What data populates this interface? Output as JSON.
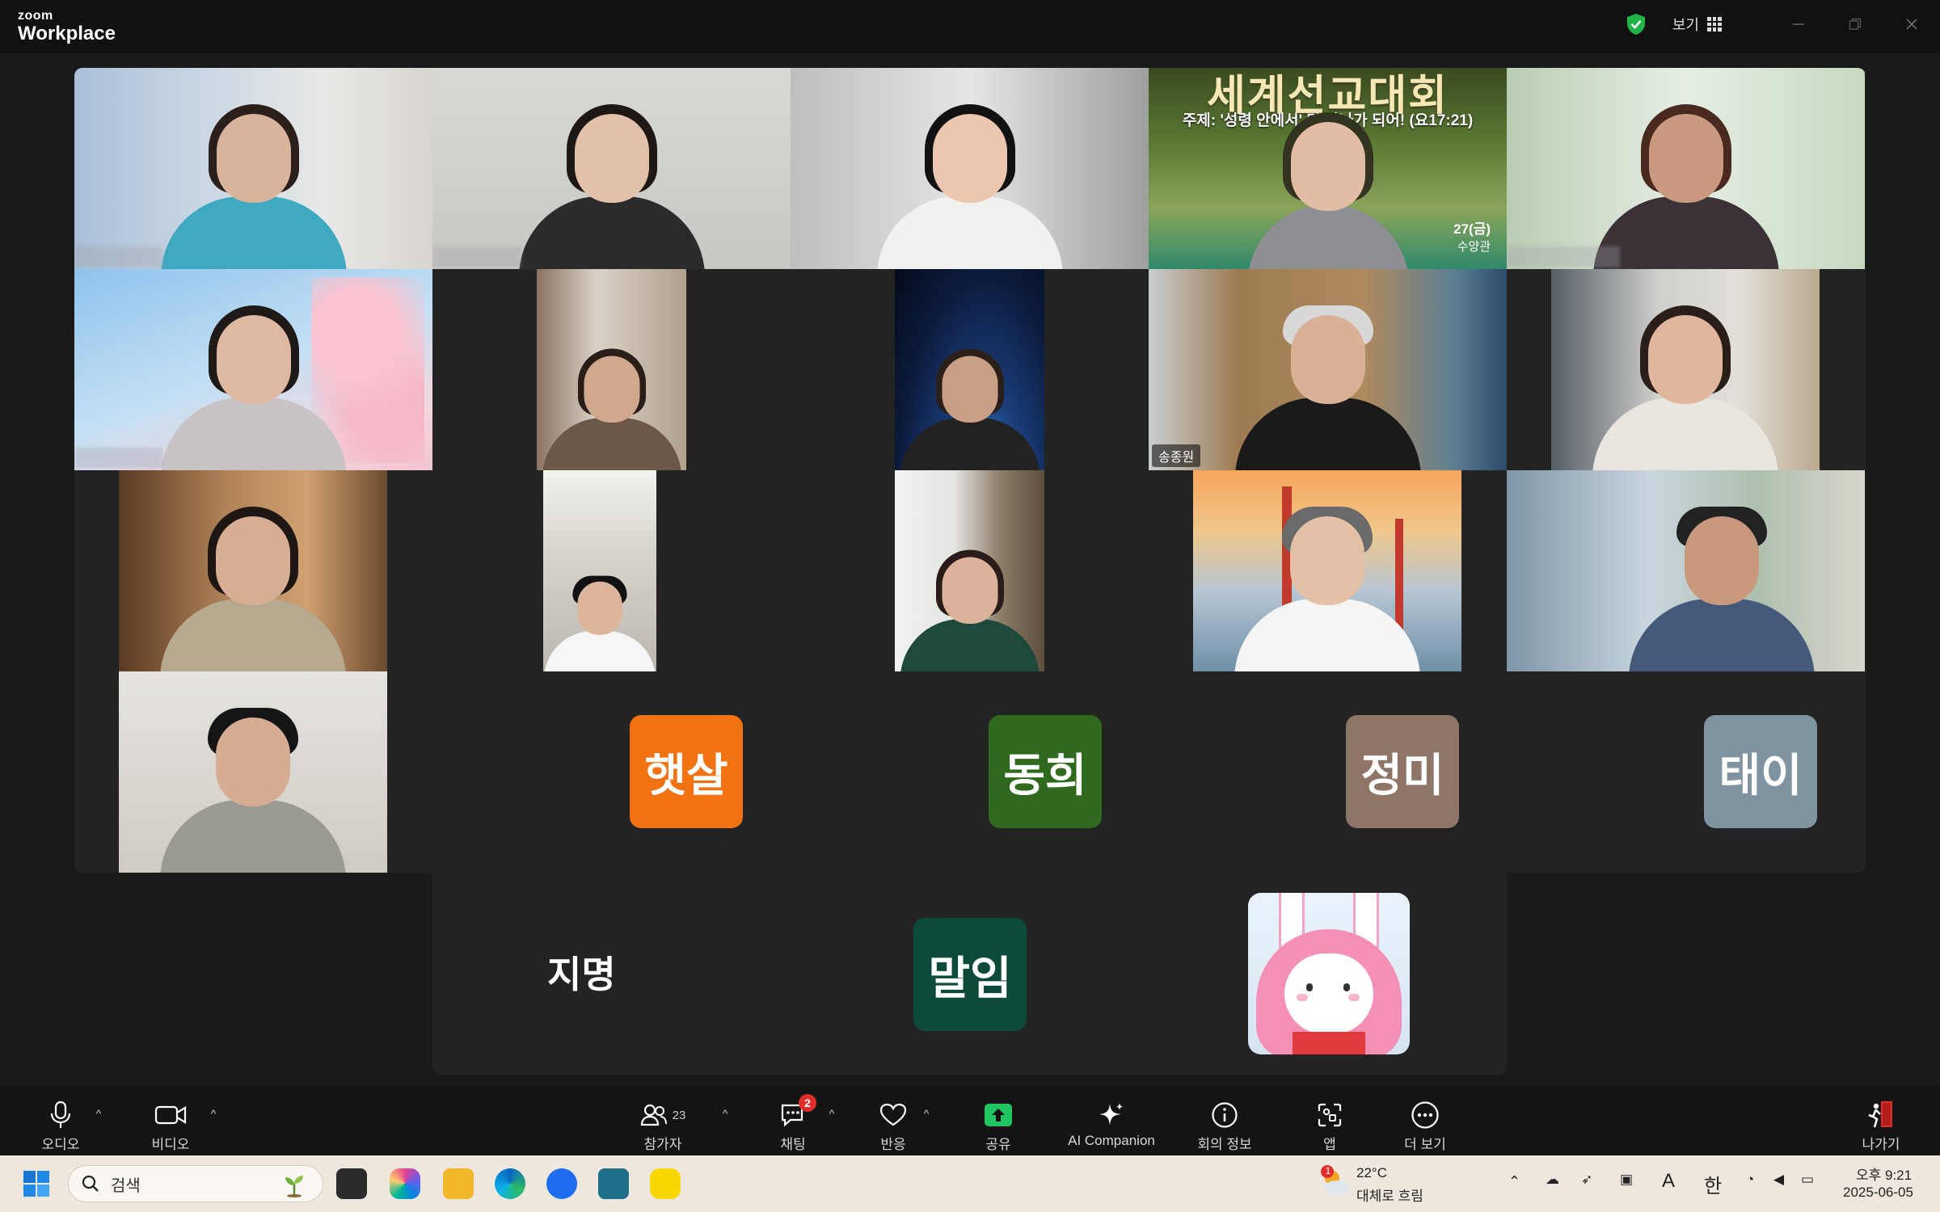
{
  "app": {
    "brand_small": "zoom",
    "brand_large": "Workplace"
  },
  "titlebar": {
    "view_label": "보기"
  },
  "banner": {
    "title": "세계선교대회",
    "subtitle": "주제: '성령 안에서' 다 하나가 되어! (요17:21)",
    "date": "27(금)",
    "venue": "수양관"
  },
  "participants": {
    "active_speaker_name": "송종원",
    "avatars": [
      {
        "label": "햇살",
        "color": "#f07212"
      },
      {
        "label": "동희",
        "color": "#2f6a1e"
      },
      {
        "label": "정미",
        "color": "#8e7568"
      },
      {
        "label": "태이",
        "color": "#7f93a0"
      },
      {
        "label": "말임",
        "color": "#0e4a3b"
      }
    ],
    "text_name": "지명"
  },
  "toolbar": {
    "audio": "오디오",
    "video": "비디오",
    "participants": "참가자",
    "participant_count": "23",
    "chat": "채팅",
    "chat_badge": "2",
    "reactions": "반응",
    "share": "공유",
    "ai": "AI Companion",
    "meeting_info": "회의 정보",
    "apps": "앱",
    "more": "더 보기",
    "leave": "나가기"
  },
  "taskbar": {
    "search_placeholder": "검색",
    "weather_badge": "1",
    "temperature": "22°C",
    "weather": "대체로 흐림",
    "ime": "한",
    "font_a": "A",
    "time": "오후 9:21",
    "date": "2025-06-05"
  }
}
